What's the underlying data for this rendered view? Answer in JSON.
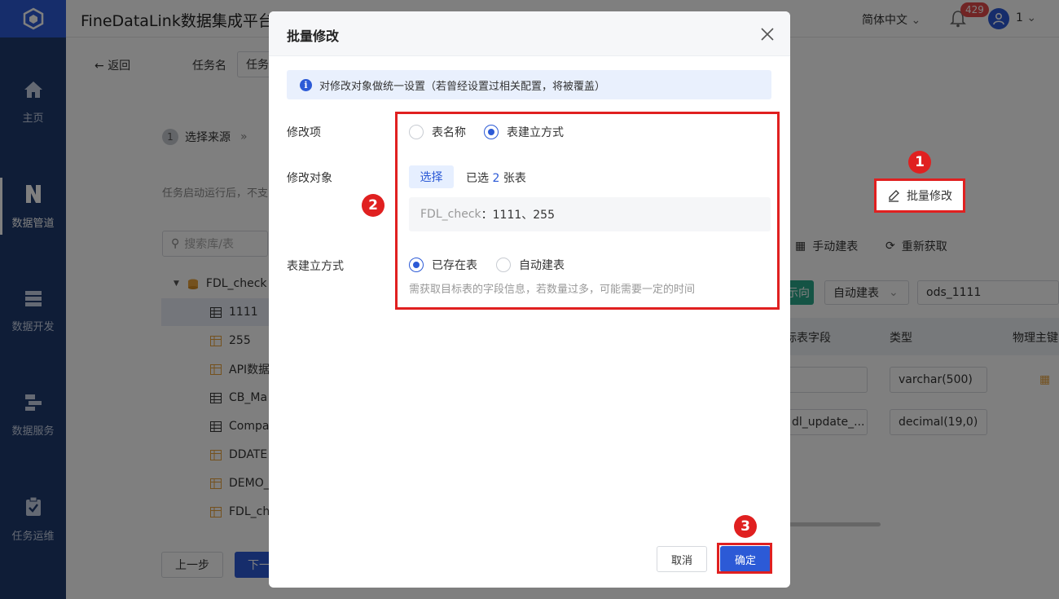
{
  "app": {
    "title": "FineDataLink数据集成平台",
    "language": "简体中文",
    "notification_count": "429",
    "user": "1"
  },
  "sidebar": {
    "items": [
      {
        "label": "主页",
        "icon": "home-icon"
      },
      {
        "label": "数据管道",
        "icon": "pipeline-icon"
      },
      {
        "label": "数据开发",
        "icon": "dev-icon"
      },
      {
        "label": "数据服务",
        "icon": "service-icon"
      },
      {
        "label": "任务运维",
        "icon": "ops-icon"
      }
    ],
    "active": "数据管道"
  },
  "background": {
    "back_label": "返回",
    "task_name_label": "任务名",
    "task_name_value": "任务",
    "step1_num": "1",
    "step1_label": "选择来源",
    "step_sep": "»",
    "description_partial": "任务启动运行后，不支",
    "search_placeholder": "搜索库/表",
    "tree": {
      "root": "FDL_check",
      "items": [
        "1111",
        "255",
        "API数据",
        "CB_Ma",
        "Compar",
        "DDATE",
        "DEMO_",
        "FDL_ch"
      ]
    },
    "batch_edit_label": "批量修改",
    "manual_create_label": "手动建表",
    "refetch_label": "重新获取",
    "direction_btn": "示向",
    "auto_create_select": "自动建表",
    "target_table_value": "ods_1111",
    "columns": {
      "target_field": "标表字段",
      "type": "类型",
      "primary_key": "物理主键"
    },
    "rows": [
      {
        "field": "",
        "type": "varchar(500)"
      },
      {
        "field": "dl_update_...",
        "type": "decimal(19,0)"
      }
    ],
    "prev_btn": "上一步",
    "next_btn": "下一"
  },
  "modal": {
    "title": "批量修改",
    "info": "对修改对象做统一设置（若曾经设置过相关配置，将被覆盖）",
    "field_modify_item": "修改项",
    "opt_table_name": "表名称",
    "opt_create_method": "表建立方式",
    "field_modify_target": "修改对象",
    "select_btn": "选择",
    "selected_prefix": "已选",
    "selected_count": "2",
    "selected_suffix": "张表",
    "target_db": "FDL_check",
    "target_tables": "1111、255",
    "field_create_method": "表建立方式",
    "opt_existing": "已存在表",
    "opt_auto": "自动建表",
    "hint": "需获取目标表的字段信息，若数量过多，可能需要一定的时间",
    "cancel": "取消",
    "confirm": "确定"
  },
  "annotations": {
    "step1": "1",
    "step2": "2",
    "step3": "3"
  },
  "colors": {
    "primary": "#2c5ad6",
    "highlight": "#e02020",
    "sidebar": "#1e3a6e"
  }
}
